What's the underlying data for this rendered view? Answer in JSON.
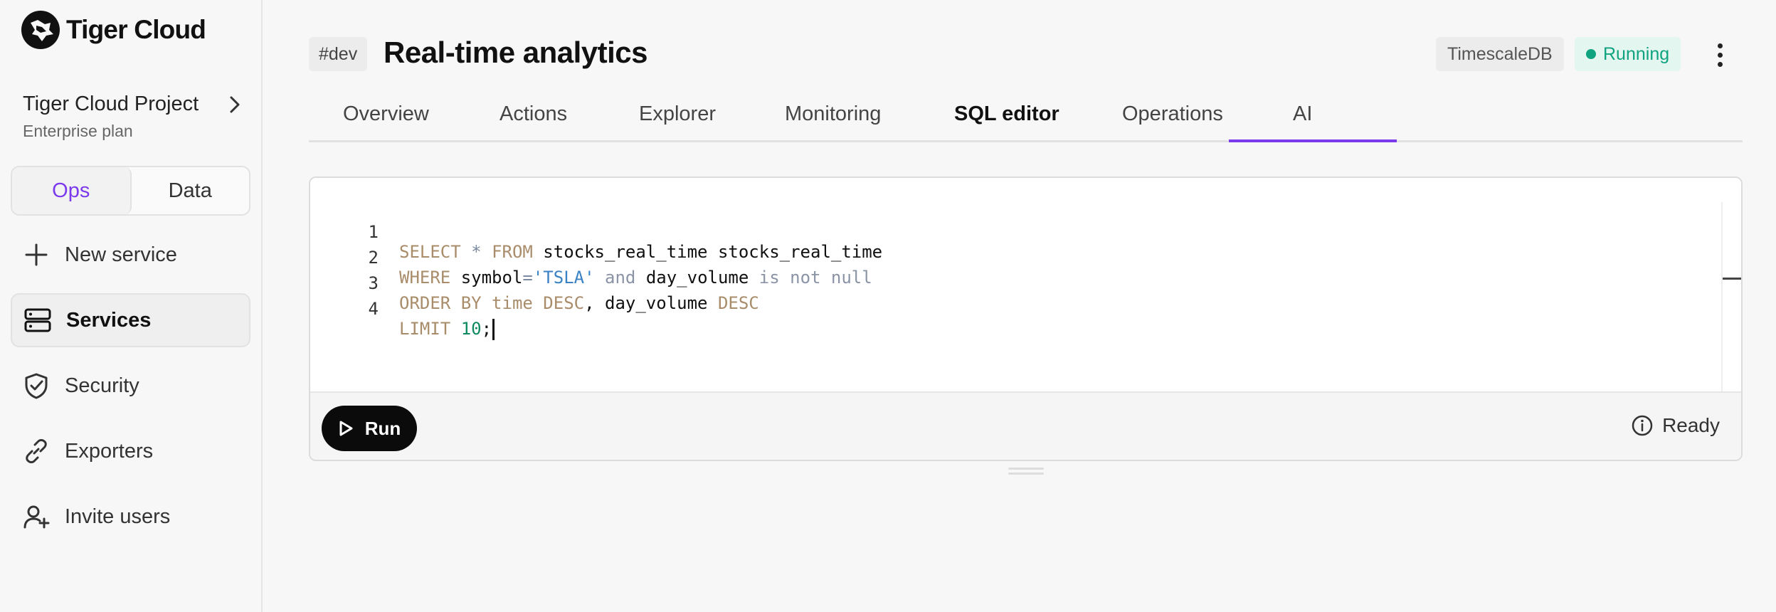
{
  "app": {
    "brand": "Tiger Cloud"
  },
  "project": {
    "name": "Tiger Cloud Project",
    "plan": "Enterprise plan"
  },
  "mode_toggle": {
    "options": [
      "Ops",
      "Data"
    ],
    "selected": "Ops"
  },
  "sidebar": {
    "items": [
      {
        "label": "New service",
        "icon": "plus-icon"
      },
      {
        "label": "Services",
        "icon": "server-icon",
        "active": true
      },
      {
        "label": "Security",
        "icon": "shield-check-icon"
      },
      {
        "label": "Exporters",
        "icon": "link-icon"
      },
      {
        "label": "Invite users",
        "icon": "user-plus-icon"
      }
    ]
  },
  "header": {
    "tag": "#dev",
    "title": "Real-time analytics",
    "db_badge": "TimescaleDB",
    "status": "Running"
  },
  "tabs": [
    {
      "label": "Overview"
    },
    {
      "label": "Actions"
    },
    {
      "label": "Explorer"
    },
    {
      "label": "Monitoring"
    },
    {
      "label": "SQL editor",
      "active": true
    },
    {
      "label": "Operations"
    },
    {
      "label": "AI"
    }
  ],
  "editor": {
    "line_numbers": [
      "1",
      "2",
      "3",
      "4"
    ],
    "lines": [
      "SELECT * FROM stocks_real_time stocks_real_time",
      "WHERE symbol='TSLA' and day_volume is not null",
      "ORDER BY time DESC, day_volume DESC",
      "LIMIT 10;"
    ],
    "run_label": "Run",
    "status": "Ready"
  },
  "colors": {
    "accent": "#7c3aed",
    "running": "#10a37f",
    "keyword": "#a98d6b",
    "string": "#3b82c4",
    "number": "#0f8a5f"
  }
}
